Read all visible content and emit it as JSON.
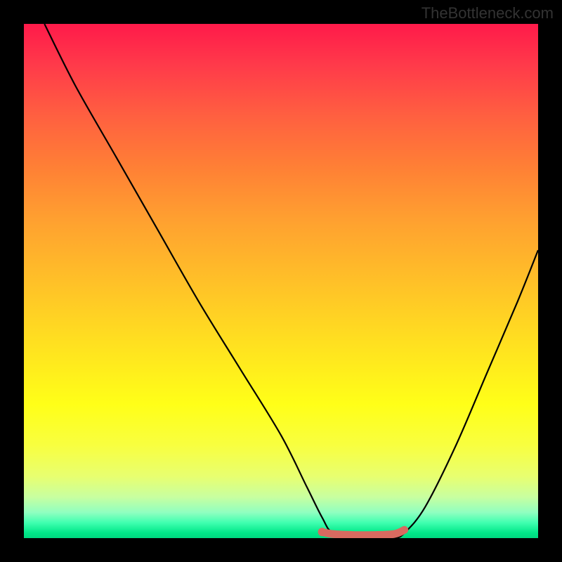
{
  "watermark": "TheBottleneck.com",
  "chart_data": {
    "type": "line",
    "title": "",
    "xlabel": "",
    "ylabel": "",
    "xlim": [
      0,
      100
    ],
    "ylim": [
      0,
      100
    ],
    "series": [
      {
        "name": "bottleneck-curve",
        "x": [
          4,
          10,
          18,
          26,
          34,
          42,
          50,
          55,
          58,
          60,
          64,
          68,
          72,
          74,
          78,
          84,
          90,
          96,
          100
        ],
        "values": [
          100,
          88,
          74,
          60,
          46,
          33,
          20,
          10,
          4,
          1,
          0,
          0,
          0,
          1,
          6,
          18,
          32,
          46,
          56
        ]
      },
      {
        "name": "optimal-range-marker",
        "x": [
          58,
          60,
          64,
          68,
          72,
          74
        ],
        "values": [
          1.2,
          0.8,
          0.6,
          0.6,
          0.8,
          1.6
        ]
      }
    ],
    "gradient_stops": [
      {
        "pct": 0,
        "color": "#ff1a4a"
      },
      {
        "pct": 50,
        "color": "#ffc028"
      },
      {
        "pct": 100,
        "color": "#00d880"
      }
    ],
    "marker_color": "#d86a60"
  }
}
